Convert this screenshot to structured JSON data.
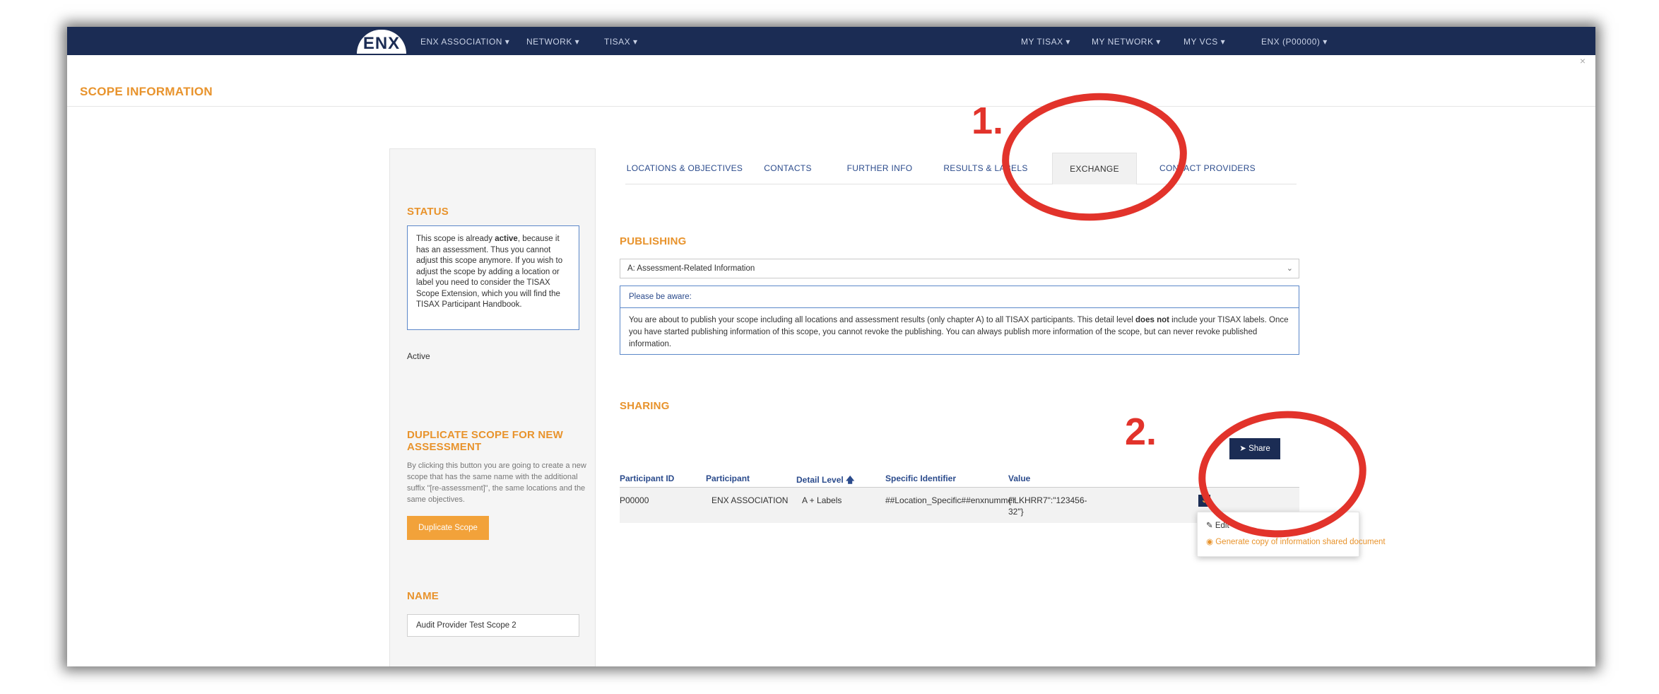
{
  "topnav": {
    "logo": "ENX",
    "items_left": [
      "ENX ASSOCIATION ▾",
      "NETWORK ▾",
      "TISAX ▾"
    ],
    "items_right": [
      "MY TISAX ▾",
      "MY NETWORK ▾",
      "MY VCS ▾",
      "ENX (P00000) ▾"
    ]
  },
  "modal": {
    "title": "SCOPE INFORMATION",
    "close": "×"
  },
  "left": {
    "status_title": "STATUS",
    "status_text_1": "This scope is already ",
    "status_text_bold": "active",
    "status_text_2": ", because it has an assessment. Thus you cannot adjust this scope anymore. If you wish to adjust the scope by adding a location or label you need to consider the TISAX Scope Extension, which you will find the TISAX Participant Handbook.",
    "status_value": "Active",
    "duplicate_title": "DUPLICATE SCOPE FOR NEW ASSESSMENT",
    "duplicate_desc": "By clicking this button you are going to create a new scope that has the same name with the additional suffix \"[re-assessment]\", the same locations and the same objectives.",
    "duplicate_button": "Duplicate Scope",
    "name_title": "NAME",
    "name_value": "Audit Provider Test Scope 2"
  },
  "tabs": [
    "LOCATIONS & OBJECTIVES",
    "CONTACTS",
    "FURTHER INFO",
    "RESULTS & LABELS",
    "EXCHANGE",
    "CONTACT PROVIDERS"
  ],
  "active_tab": "EXCHANGE",
  "publishing": {
    "title": "PUBLISHING",
    "selected": "A: Assessment-Related Information",
    "notice_head": "Please be aware:",
    "notice_1": "You are about to publish your scope including all locations and assessment results (only chapter A) to all TISAX participants. This detail level ",
    "notice_bold": "does not",
    "notice_2": " include your TISAX labels. Once you have started publishing information of this scope, you cannot revoke the publishing. You can always publish more information of the scope, but can never revoke published information."
  },
  "sharing": {
    "title": "SHARING",
    "share_button": "Share",
    "columns": [
      "Participant ID",
      "Participant",
      "Detail Level 🡅",
      "Specific Identifier",
      "Value"
    ],
    "row": {
      "participant_id": "P00000",
      "participant": "ENX ASSOCIATION",
      "detail_level": "A + Labels",
      "specific_identifier": "##Location_Specific##enxnummer",
      "value_line1": "{\"LKHRR7\":\"123456-",
      "value_line2": "32\"}"
    },
    "menu": [
      "Edit",
      "Generate copy of information shared document"
    ]
  },
  "annotations": {
    "one": "1.",
    "two": "2."
  },
  "colors": {
    "nav": "#1b2c54",
    "accent": "#e8932c",
    "annotation": "#e2332b",
    "link": "#2b4b8c"
  }
}
